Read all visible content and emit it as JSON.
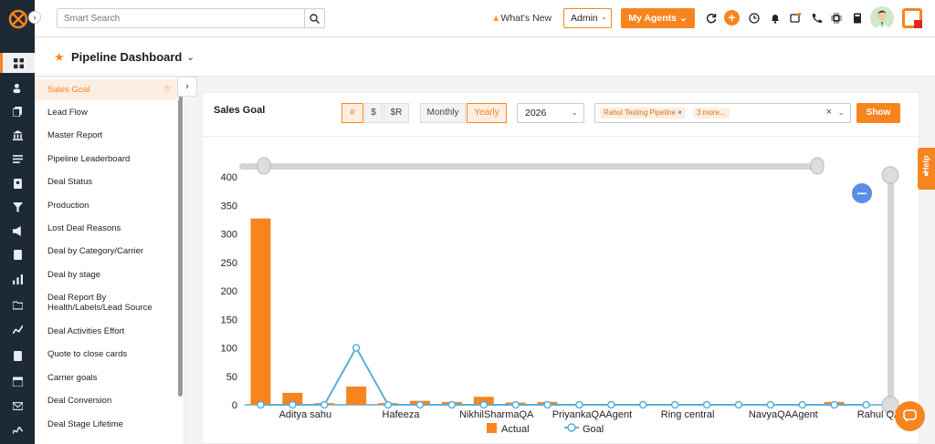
{
  "topbar": {
    "search_placeholder": "Smart Search",
    "whats_new": "What's New",
    "role_select": "Admin",
    "my_agents": "My Agents"
  },
  "page": {
    "title": "Pipeline Dashboard"
  },
  "subnav": {
    "items": [
      {
        "label": "Sales Goal",
        "active": true
      },
      {
        "label": "Lead Flow"
      },
      {
        "label": "Master Report"
      },
      {
        "label": "Pipeline Leaderboard"
      },
      {
        "label": "Deal Status"
      },
      {
        "label": "Production"
      },
      {
        "label": "Lost Deal Reasons"
      },
      {
        "label": "Deal by Category/Carrier"
      },
      {
        "label": "Deal by stage"
      },
      {
        "label": "Deal Report By Health/Labels/Lead Source"
      },
      {
        "label": "Deal Activities Effort"
      },
      {
        "label": "Quote to close cards"
      },
      {
        "label": "Carrier goals"
      },
      {
        "label": "Deal Conversion"
      },
      {
        "label": "Deal Stage Lifetime"
      }
    ]
  },
  "card": {
    "title": "Sales Goal",
    "metric_toggle": [
      "#",
      "$",
      "$R"
    ],
    "metric_selected": "#",
    "period_toggle": [
      "Monthly",
      "Yearly"
    ],
    "period_selected": "Yearly",
    "year": "2026",
    "pipeline_chip": "Rahul Testing Pipeline",
    "more_chip": "3 more...",
    "show_button": "Show"
  },
  "chart_data": {
    "type": "bar",
    "ylim": [
      0,
      400
    ],
    "yticks": [
      0,
      50,
      100,
      150,
      200,
      250,
      300,
      350,
      400
    ],
    "x_labels_shown": [
      "Aditya sahu",
      "Hafeeza",
      "NikhilSharmaQA",
      "PriyankaQAAgent",
      "Ring  central",
      "NavyaQAAgent",
      "Rahul QA"
    ],
    "series": [
      {
        "name": "Actual",
        "type": "bar",
        "color": "#f7851f",
        "values": [
          327,
          21,
          3,
          32,
          3,
          7,
          5,
          14,
          4,
          5,
          0,
          0,
          1,
          0,
          0,
          0,
          0,
          0,
          5,
          0
        ]
      },
      {
        "name": "Goal",
        "type": "line",
        "color": "#5aaed6",
        "values": [
          0,
          0,
          0,
          100,
          0,
          0,
          0,
          0,
          0,
          0,
          0,
          0,
          0,
          0,
          0,
          0,
          0,
          0,
          0,
          0
        ]
      }
    ],
    "legend": "bottom"
  },
  "help_label": "Help"
}
